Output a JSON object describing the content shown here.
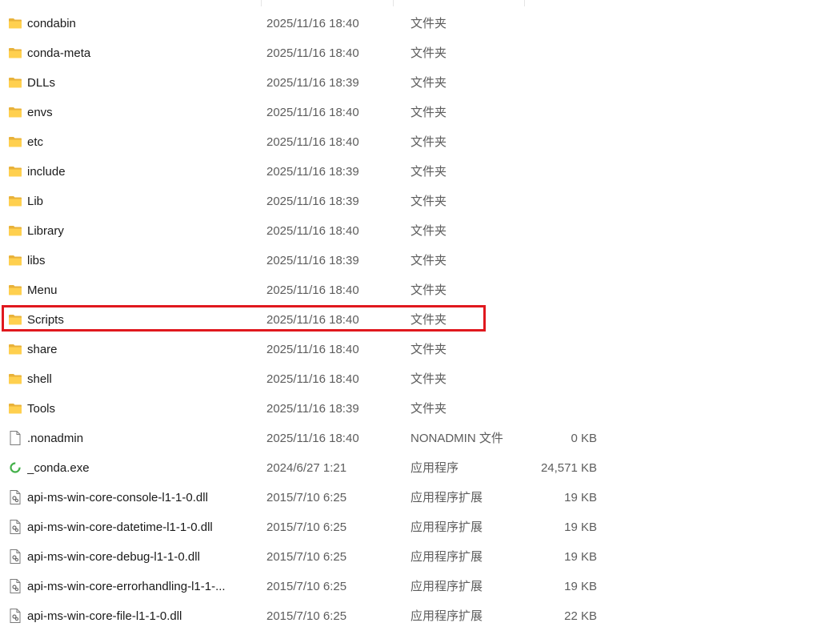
{
  "list": {
    "rows": [
      {
        "name": "condabin",
        "date": "2025/11/16 18:40",
        "type": "文件夹",
        "size": "",
        "icon": "folder-icon"
      },
      {
        "name": "conda-meta",
        "date": "2025/11/16 18:40",
        "type": "文件夹",
        "size": "",
        "icon": "folder-icon"
      },
      {
        "name": "DLLs",
        "date": "2025/11/16 18:39",
        "type": "文件夹",
        "size": "",
        "icon": "folder-icon"
      },
      {
        "name": "envs",
        "date": "2025/11/16 18:40",
        "type": "文件夹",
        "size": "",
        "icon": "folder-icon"
      },
      {
        "name": "etc",
        "date": "2025/11/16 18:40",
        "type": "文件夹",
        "size": "",
        "icon": "folder-icon"
      },
      {
        "name": "include",
        "date": "2025/11/16 18:39",
        "type": "文件夹",
        "size": "",
        "icon": "folder-icon"
      },
      {
        "name": "Lib",
        "date": "2025/11/16 18:39",
        "type": "文件夹",
        "size": "",
        "icon": "folder-icon"
      },
      {
        "name": "Library",
        "date": "2025/11/16 18:40",
        "type": "文件夹",
        "size": "",
        "icon": "folder-icon"
      },
      {
        "name": "libs",
        "date": "2025/11/16 18:39",
        "type": "文件夹",
        "size": "",
        "icon": "folder-icon"
      },
      {
        "name": "Menu",
        "date": "2025/11/16 18:40",
        "type": "文件夹",
        "size": "",
        "icon": "folder-icon"
      },
      {
        "name": "Scripts",
        "date": "2025/11/16 18:40",
        "type": "文件夹",
        "size": "",
        "icon": "folder-icon"
      },
      {
        "name": "share",
        "date": "2025/11/16 18:40",
        "type": "文件夹",
        "size": "",
        "icon": "folder-icon"
      },
      {
        "name": "shell",
        "date": "2025/11/16 18:40",
        "type": "文件夹",
        "size": "",
        "icon": "folder-icon"
      },
      {
        "name": "Tools",
        "date": "2025/11/16 18:39",
        "type": "文件夹",
        "size": "",
        "icon": "folder-icon"
      },
      {
        "name": ".nonadmin",
        "date": "2025/11/16 18:40",
        "type": "NONADMIN 文件",
        "size": "0 KB",
        "icon": "file-icon"
      },
      {
        "name": "_conda.exe",
        "date": "2024/6/27 1:21",
        "type": "应用程序",
        "size": "24,571 KB",
        "icon": "exe-icon"
      },
      {
        "name": "api-ms-win-core-console-l1-1-0.dll",
        "date": "2015/7/10 6:25",
        "type": "应用程序扩展",
        "size": "19 KB",
        "icon": "dll-icon"
      },
      {
        "name": "api-ms-win-core-datetime-l1-1-0.dll",
        "date": "2015/7/10 6:25",
        "type": "应用程序扩展",
        "size": "19 KB",
        "icon": "dll-icon"
      },
      {
        "name": "api-ms-win-core-debug-l1-1-0.dll",
        "date": "2015/7/10 6:25",
        "type": "应用程序扩展",
        "size": "19 KB",
        "icon": "dll-icon"
      },
      {
        "name": "api-ms-win-core-errorhandling-l1-1-...",
        "date": "2015/7/10 6:25",
        "type": "应用程序扩展",
        "size": "19 KB",
        "icon": "dll-icon"
      },
      {
        "name": "api-ms-win-core-file-l1-1-0.dll",
        "date": "2015/7/10 6:25",
        "type": "应用程序扩展",
        "size": "22 KB",
        "icon": "dll-icon"
      }
    ],
    "highlighted_row": "Scripts",
    "highlight_color": "#e0181e"
  }
}
